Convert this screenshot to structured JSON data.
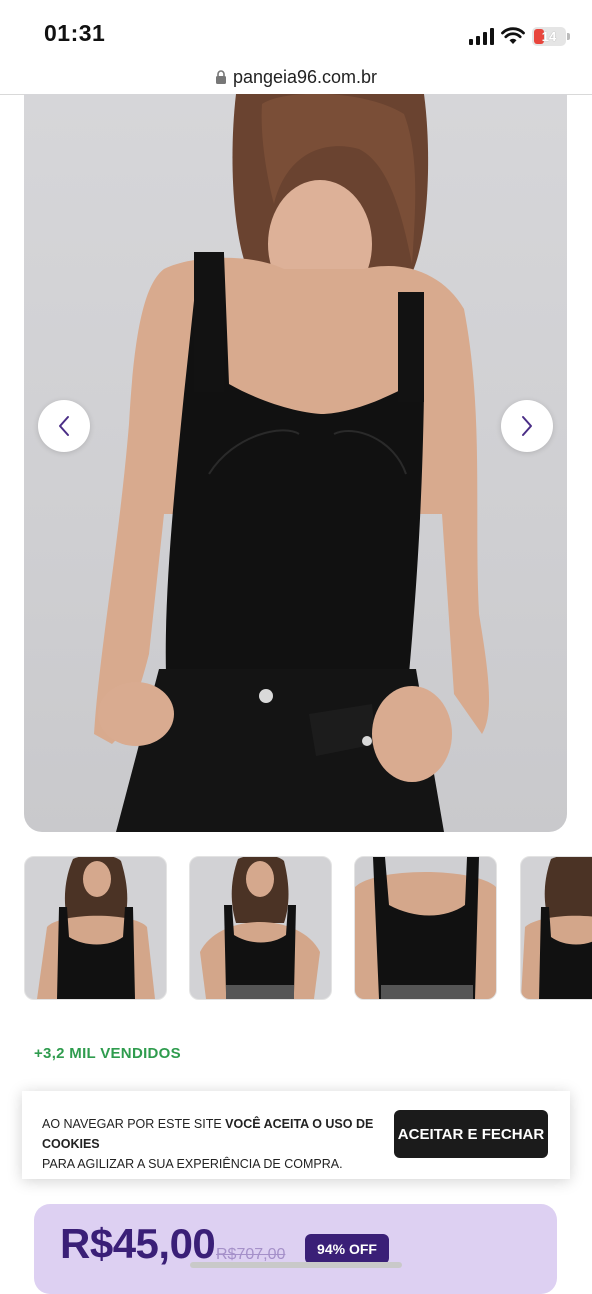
{
  "status_bar": {
    "time": "01:31",
    "battery": "14"
  },
  "browser": {
    "url": "pangeia96.com.br"
  },
  "product": {
    "sold_text": "+3,2 MIL VENDIDOS",
    "price": "R$45,00",
    "old_price": "R$707,00",
    "discount": "94% OFF"
  },
  "cookie_banner": {
    "text_start": "AO NAVEGAR POR ESTE SITE ",
    "text_bold": "VOCÊ ACEITA O USO DE COOKIES",
    "text_end": "PARA AGILIZAR A SUA EXPERIÊNCIA DE COMPRA.",
    "button_label": "ACEITAR E FECHAR"
  },
  "colors": {
    "accent": "#3a1f77",
    "sold_green": "#2f9c4e",
    "price_box_bg": "#ddd0f2"
  }
}
